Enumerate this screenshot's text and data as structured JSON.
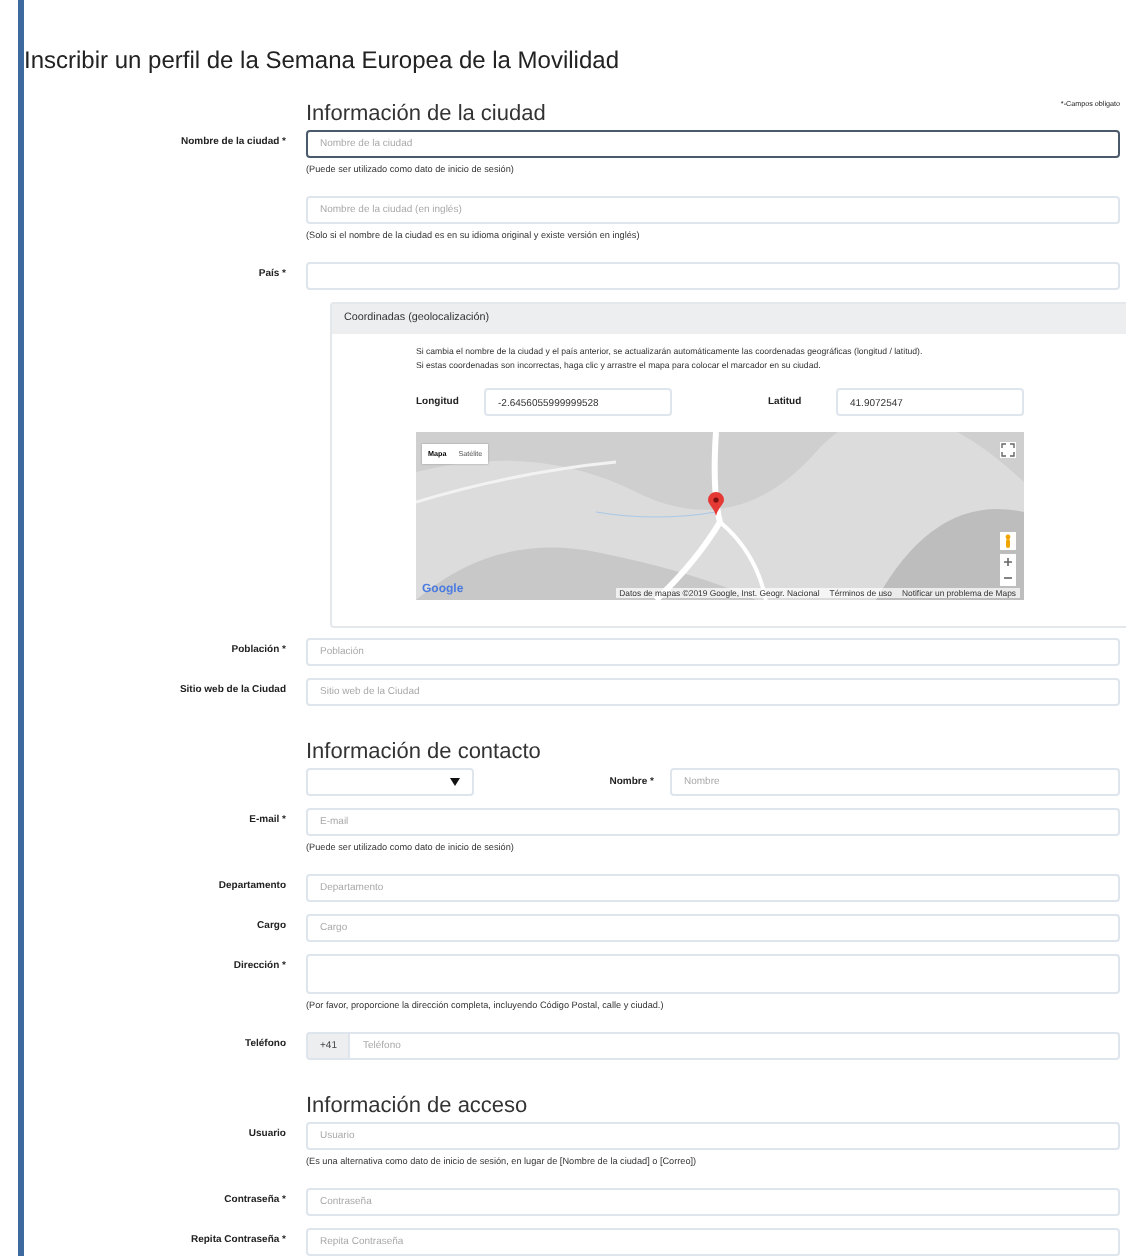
{
  "title": "Inscribir un perfil de la Semana Europea de la Movilidad",
  "sections": [
    {
      "heading": "Información de la ciudad",
      "note": "*-Campos obligato",
      "rows": [
        {
          "kind": "input",
          "label": "Nombre de la ciudad *",
          "placeholder": "Nombre de la ciudad",
          "hint": "(Puede ser utilizado como dato de inicio de sesión)",
          "focused": true
        },
        {
          "kind": "input",
          "placeholder": "Nombre de la ciudad (en inglés)",
          "hint": "(Solo si el nombre de la ciudad es en su idioma original y existe versión en inglés)",
          "focused": false
        },
        {
          "kind": "input",
          "label": "País *",
          "focused": false
        },
        {
          "kind": "geo",
          "header": "Coordinadas (geolocalización)",
          "lines": [
            "Si cambia el nombre de la ciudad y el país anterior, se actualizarán automáticamente las coordenadas geográficas (longitud / latitud).",
            "Si estas coordenadas son incorrectas, haga clic y arrastre el mapa para colocar el marcador en su ciudad."
          ],
          "longitude": {
            "label": "Longitud",
            "value": "-2.6456055999999528"
          },
          "latitude": {
            "label": "Latitud",
            "value": "41.9072547"
          },
          "map": {
            "map_types": [
              {
                "label": "Mapa",
                "selected": true
              },
              {
                "label": "Satélite",
                "selected": false
              }
            ],
            "logo": "Google",
            "footer": [
              "Datos de mapas ©2019 Google, Inst. Geogr. Nacional",
              "Términos de uso",
              "Notificar un problema de Maps"
            ]
          }
        },
        {
          "kind": "input",
          "label": "Población *",
          "placeholder": "Población",
          "focused": false
        },
        {
          "kind": "input",
          "label": "Sitio web de la Ciudad",
          "placeholder": "Sitio web de la Ciudad",
          "focused": false
        }
      ]
    },
    {
      "heading": "Información de contacto",
      "rows": [
        {
          "kind": "select-name",
          "label": "Nombre *",
          "placeholder": "Nombre"
        },
        {
          "kind": "input",
          "label": "E-mail *",
          "placeholder": "E-mail",
          "hint": "(Puede ser utilizado como dato de inicio de sesión)",
          "focused": false
        },
        {
          "kind": "input",
          "label": "Departamento",
          "placeholder": "Departamento",
          "focused": false
        },
        {
          "kind": "input",
          "label": "Cargo",
          "placeholder": "Cargo",
          "focused": false
        },
        {
          "kind": "textarea",
          "label": "Dirección *",
          "hint": "(Por favor, proporcione la dirección completa, incluyendo Código Postal, calle y ciudad.)"
        },
        {
          "kind": "phone",
          "label": "Teléfono",
          "prefix": "+41",
          "placeholder": "Teléfono"
        }
      ]
    },
    {
      "heading": "Información de acceso",
      "rows": [
        {
          "kind": "input",
          "label": "Usuario",
          "placeholder": "Usuario",
          "hint": "(Es una alternativa como dato de inicio de sesión, en lugar de [Nombre de la ciudad] o [Correo])",
          "focused": false
        },
        {
          "kind": "input",
          "label": "Contraseña *",
          "placeholder": "Contraseña",
          "focused": false
        },
        {
          "kind": "input",
          "label": "Repita Contraseña *",
          "placeholder": "Repita Contraseña",
          "focused": false
        }
      ]
    }
  ]
}
